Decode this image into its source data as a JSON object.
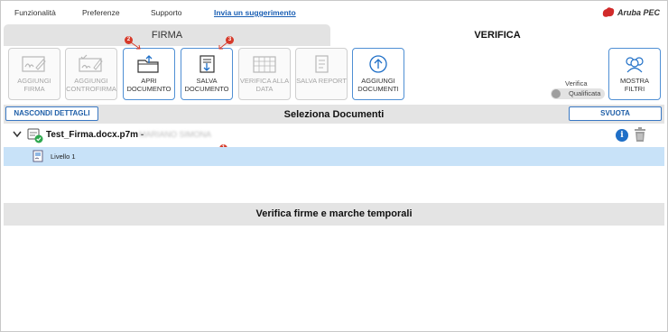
{
  "menu": {
    "items": [
      "Funzionalità",
      "Preferenze",
      "Supporto"
    ],
    "link": "Invia un suggerimento",
    "logo": "Aruba PEC"
  },
  "tabs": {
    "firma": "FIRMA",
    "verifica": "VERIFICA"
  },
  "toolbar": {
    "buttons": [
      {
        "label": "AGGIUNGI FIRMA",
        "icon": "signature-icon",
        "enabled": false
      },
      {
        "label": "AGGIUNGI CONTROFIRMA",
        "icon": "countersign-icon",
        "enabled": false
      },
      {
        "label": "APRI DOCUMENTO",
        "icon": "open-folder-icon",
        "enabled": true,
        "badge": "2"
      },
      {
        "label": "SALVA DOCUMENTO",
        "icon": "save-document-icon",
        "enabled": true,
        "badge": "3"
      },
      {
        "label": "VERIFICA ALLA DATA",
        "icon": "calendar-icon",
        "enabled": false
      },
      {
        "label": "SALVA REPORT",
        "icon": "report-icon",
        "enabled": false
      },
      {
        "label": "AGGIUNGI DOCUMENTI",
        "icon": "add-documents-icon",
        "enabled": true
      }
    ],
    "verifica_label": "Verifica",
    "toggle_label": "Qualificata",
    "mostra_filtri": "MOSTRA FILTRI"
  },
  "documents": {
    "hide_details": "NASCONDI DETTAGLI",
    "title": "Seleziona Documenti",
    "empty": "SVUOTA",
    "file_name": "Test_Firma.docx.p7m",
    "separator": "-",
    "signer": "MARIANO SIMONA",
    "level": "Livello 1",
    "level_badge": "1"
  },
  "verification": {
    "title": "Verifica firme e marche temporali"
  },
  "colors": {
    "accent": "#1f6fc7",
    "badge": "#d63a2a",
    "selected_row": "#c8e2f8",
    "bar": "#e4e4e4"
  }
}
